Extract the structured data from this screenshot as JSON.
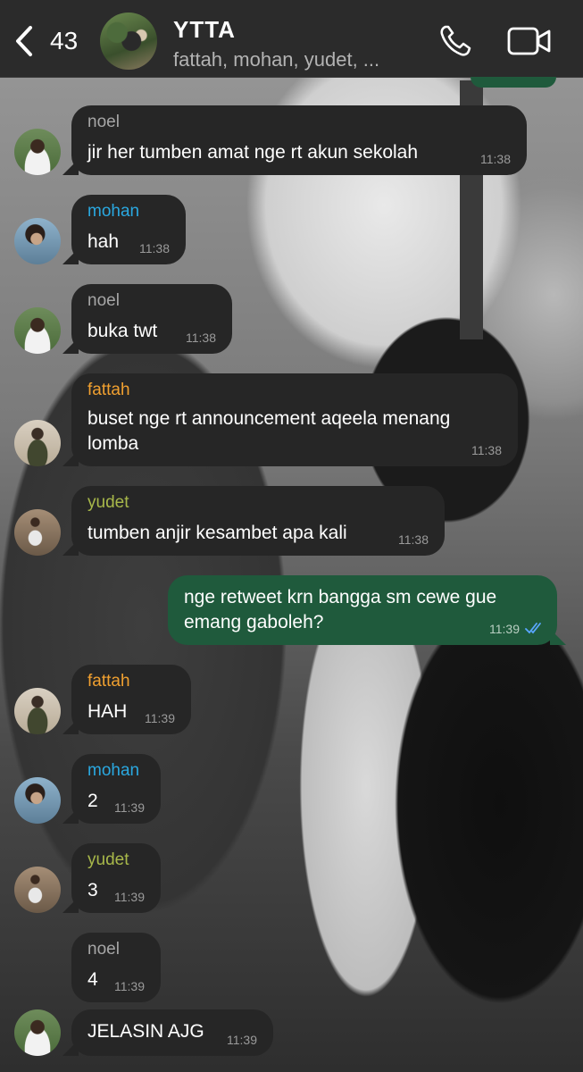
{
  "header": {
    "back_count": "43",
    "group_name": "YTTA",
    "members": "fattah, mohan, yudet, ..."
  },
  "colors": {
    "noel": "#a6a6a6",
    "mohan": "#2aa8e0",
    "fattah": "#f0a030",
    "yudet": "#a8b84a",
    "outgoing_bubble": "#1f5a3c",
    "incoming_bubble": "#262626"
  },
  "messages": [
    {
      "sender": "noel",
      "text": "jir her tumben amat nge rt akun sekolah",
      "time": "11:38"
    },
    {
      "sender": "mohan",
      "text": "hah",
      "time": "11:38"
    },
    {
      "sender": "noel",
      "text": "buka twt",
      "time": "11:38"
    },
    {
      "sender": "fattah",
      "lines": [
        "buset nge rt announcement aqeela menang",
        "lomba"
      ],
      "time": "11:38"
    },
    {
      "sender": "yudet",
      "text": "tumben anjir kesambet apa kali",
      "time": "11:38"
    },
    {
      "lines": [
        "nge retweet krn bangga sm cewe gue",
        "emang gaboleh?"
      ],
      "time": "11:39",
      "outgoing": true,
      "status": "read-ticks"
    },
    {
      "sender": "fattah",
      "text": "HAH",
      "time": "11:39"
    },
    {
      "sender": "mohan",
      "text": "2",
      "time": "11:39"
    },
    {
      "sender": "yudet",
      "text": "3",
      "time": "11:39"
    },
    {
      "sender": "noel",
      "text": "4",
      "time": "11:39"
    },
    {
      "text": "JELASIN AJG",
      "time": "11:39"
    }
  ]
}
